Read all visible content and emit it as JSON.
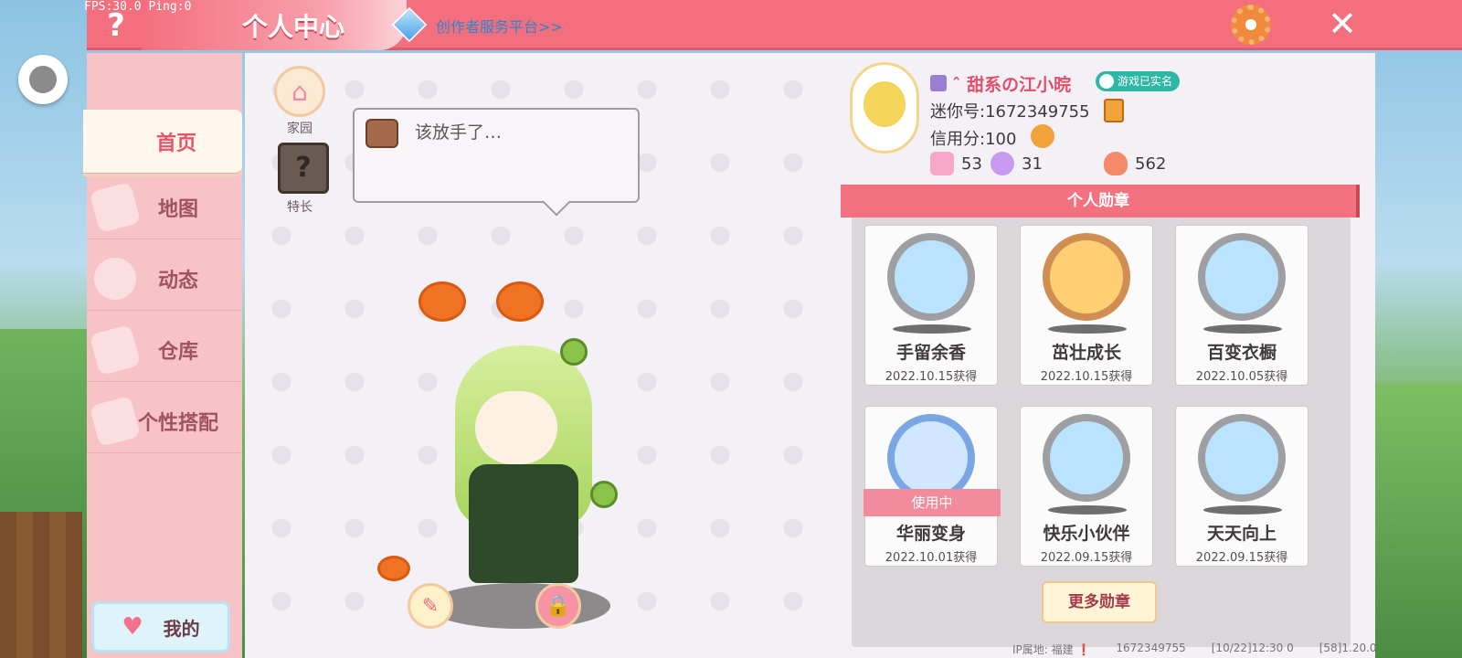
{
  "debug": {
    "fps_ping": "FPS:30.0  Ping:0"
  },
  "header": {
    "title": "个人中心",
    "creator_link": "创作者服务平台>>",
    "help_symbol": "?",
    "close_symbol": "✕"
  },
  "sidebar": {
    "items": [
      {
        "label": "首页",
        "active": true
      },
      {
        "label": "地图"
      },
      {
        "label": "动态"
      },
      {
        "label": "仓库"
      },
      {
        "label": "个性搭配"
      }
    ],
    "mine_label": "我的"
  },
  "center": {
    "home_label": "家园",
    "skill_label": "特长",
    "skill_symbol": "?",
    "speech": "该放手了…"
  },
  "profile": {
    "nickname": "ˆ 甜系の江小晥",
    "realname_badge": "游戏已实名",
    "mini_id": "迷你号:1672349755",
    "credit": "信用分:100",
    "stats": [
      {
        "icon": "pink-plus-icon",
        "value": "53"
      },
      {
        "icon": "cheer-icon",
        "value": "31"
      },
      {
        "icon": "flame-icon",
        "value": "562"
      }
    ]
  },
  "medals": {
    "header": "个人勋章",
    "items": [
      {
        "name": "手留余香",
        "date": "2022.10.15获得",
        "style": "silver"
      },
      {
        "name": "茁壮成长",
        "date": "2022.10.15获得",
        "style": "gold"
      },
      {
        "name": "百变衣橱",
        "date": "2022.10.05获得",
        "style": "silver"
      },
      {
        "name": "华丽变身",
        "date": "2022.10.01获得",
        "style": "blue",
        "in_use": "使用中"
      },
      {
        "name": "快乐小伙伴",
        "date": "2022.09.15获得",
        "style": "silver"
      },
      {
        "name": "天天向上",
        "date": "2022.09.15获得",
        "style": "silver"
      }
    ],
    "more_label": "更多勋章"
  },
  "footer": {
    "ip": "IP属地: 福建 ❗",
    "uid": "1672349755",
    "time": "[10/22]12:30 0",
    "version": "[58]1.20.0"
  },
  "colors": {
    "accent": "#f46f7e",
    "sidebar_bg": "#f8c3c7",
    "panel_bg": "#f4f1f6"
  }
}
